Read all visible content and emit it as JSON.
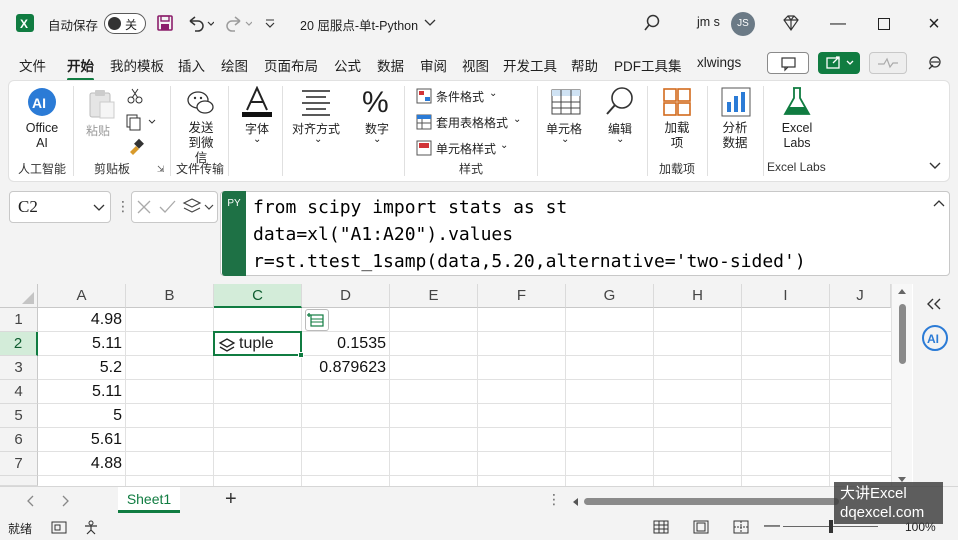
{
  "titlebar": {
    "autosave_label": "自动保存",
    "autosave_state": "关",
    "filename": "20 屈服点-单t-Python",
    "user_name": "jm s",
    "user_initials": "JS"
  },
  "tabs": [
    "文件",
    "开始",
    "我的模板",
    "插入",
    "绘图",
    "页面布局",
    "公式",
    "数据",
    "审阅",
    "视图",
    "开发工具",
    "帮助",
    "PDF工具集",
    "xlwings"
  ],
  "active_tab": "开始",
  "ribbon": {
    "office_ai": "Office AI",
    "paste": "粘贴",
    "send_wechat": "发送到微信",
    "font": "字体",
    "align": "对齐方式",
    "number": "数字",
    "cond_format": "条件格式",
    "table_format": "套用表格格式",
    "cell_style": "单元格样式",
    "cells": "单元格",
    "edit": "编辑",
    "addins": "加载项",
    "analyze": "分析数据",
    "excel_labs": "Excel Labs",
    "groups": {
      "ai": "人工智能",
      "clipboard": "剪贴板",
      "file_transfer": "文件传输",
      "styles": "样式",
      "addins": "加载项",
      "excel_labs": "Excel Labs"
    }
  },
  "formula_bar": {
    "name_box": "C2",
    "mode_badge": "PY",
    "lines": [
      "from scipy import stats as st",
      "data=xl(\"A1:A20\").values",
      "r=st.ttest_1samp(data,5.20,alternative='two-sided')"
    ]
  },
  "columns": [
    "A",
    "B",
    "C",
    "D",
    "E",
    "F",
    "G",
    "H",
    "I",
    "J"
  ],
  "selected_column": "C",
  "rows": [
    "1",
    "2",
    "3",
    "4",
    "5",
    "6",
    "7"
  ],
  "selected_row": "2",
  "cells": {
    "A": [
      "4.98",
      "5.11",
      "5.2",
      "5.11",
      "5",
      "5.61",
      "4.88"
    ],
    "C2": "tuple",
    "D2": "0.1535",
    "D3": "0.879623"
  },
  "sheet_tab": "Sheet1",
  "status": {
    "ready": "就绪",
    "zoom": "100%"
  },
  "watermark": {
    "line1": "大讲Excel",
    "line2": "dqexcel.com"
  },
  "colors": {
    "accent": "#107c41",
    "py_badge": "#1e7145"
  }
}
